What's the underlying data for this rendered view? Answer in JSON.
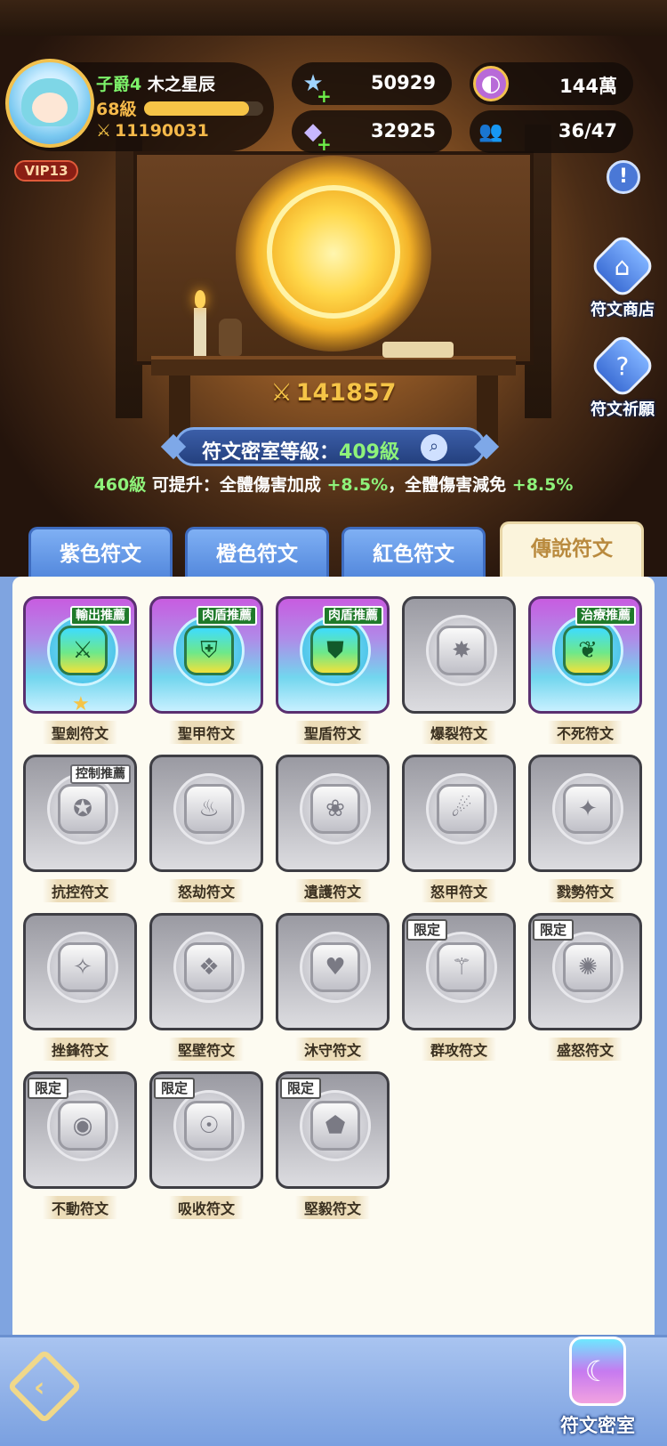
{
  "player": {
    "title": "子爵4",
    "name": "木之星辰",
    "level": "68級",
    "xp_progress": 0.88,
    "power": "11190031",
    "vip": "VIP13"
  },
  "resources": [
    {
      "icon": "star-gem-icon",
      "value": "50929"
    },
    {
      "icon": "purple-coin-icon",
      "value": "144萬"
    },
    {
      "icon": "crystal-icon",
      "value": "32925"
    },
    {
      "icon": "players-icon",
      "value": "36/47"
    }
  ],
  "side": {
    "shop_label": "符文商店",
    "pray_label": "符文祈願"
  },
  "chamber": {
    "power": "141857",
    "level_label": "符文密室等級：",
    "level_value": "409級",
    "upgrade_level": "460級",
    "upgrade_text": "可提升：全體傷害加成",
    "upgrade_val1": "+8.5%",
    "upgrade_text2": "，全體傷害減免",
    "upgrade_val2": "+8.5%"
  },
  "tabs": [
    "紫色符文",
    "橙色符文",
    "紅色符文",
    "傳說符文"
  ],
  "active_tab": 3,
  "runes": [
    {
      "name": "聖劍符文",
      "tag": "輸出推薦",
      "active": true,
      "star": "★",
      "glyph": "⚔"
    },
    {
      "name": "聖甲符文",
      "tag": "肉盾推薦",
      "active": true,
      "glyph": "⛨"
    },
    {
      "name": "聖盾符文",
      "tag": "肉盾推薦",
      "active": true,
      "glyph": "⛊"
    },
    {
      "name": "爆裂符文",
      "active": false,
      "glyph": "✸"
    },
    {
      "name": "不死符文",
      "tag": "治療推薦",
      "active": true,
      "glyph": "❦"
    },
    {
      "name": "抗控符文",
      "tag": "控制推薦",
      "active": false,
      "glyph": "✪"
    },
    {
      "name": "怒劫符文",
      "active": false,
      "glyph": "♨"
    },
    {
      "name": "遺護符文",
      "active": false,
      "glyph": "❀"
    },
    {
      "name": "怒甲符文",
      "active": false,
      "glyph": "☄"
    },
    {
      "name": "戮勢符文",
      "active": false,
      "glyph": "✦"
    },
    {
      "name": "挫鋒符文",
      "active": false,
      "glyph": "✧"
    },
    {
      "name": "堅壁符文",
      "active": false,
      "glyph": "❖"
    },
    {
      "name": "沐守符文",
      "active": false,
      "glyph": "♥"
    },
    {
      "name": "群攻符文",
      "limited": "限定",
      "active": false,
      "glyph": "⚚"
    },
    {
      "name": "盛怒符文",
      "limited": "限定",
      "active": false,
      "glyph": "✺"
    },
    {
      "name": "不動符文",
      "limited": "限定",
      "active": false,
      "glyph": "◉"
    },
    {
      "name": "吸收符文",
      "limited": "限定",
      "active": false,
      "glyph": "☉"
    },
    {
      "name": "堅毅符文",
      "limited": "限定",
      "active": false,
      "glyph": "⬟"
    }
  ],
  "bottom": {
    "room_label": "符文密室"
  }
}
